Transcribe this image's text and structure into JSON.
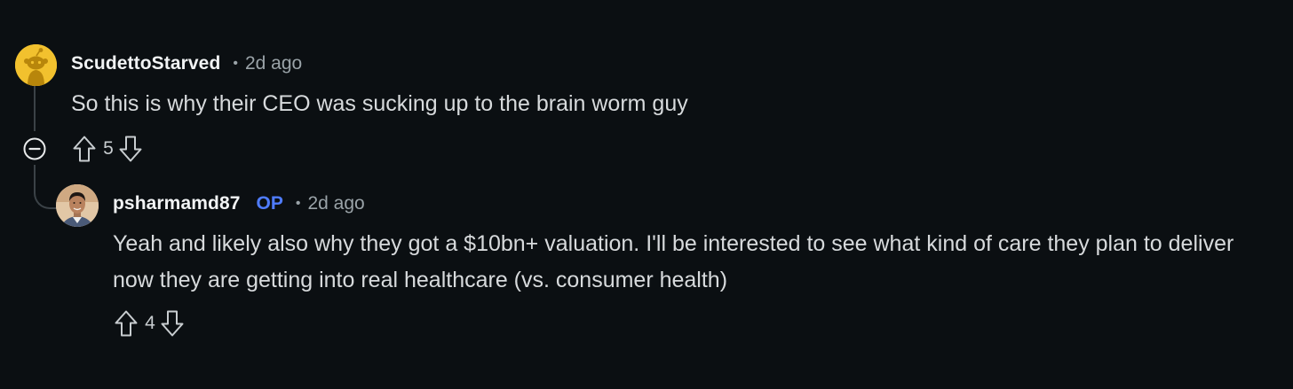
{
  "comments": [
    {
      "username": "ScudettoStarved",
      "separator": "•",
      "timestamp": "2d ago",
      "body": "So this is why their CEO was sucking up to the brain worm guy",
      "score": "5",
      "avatar_icon": "reddit-snoo-avatar-icon",
      "avatar_color": "#f2c12e"
    },
    {
      "username": "psharmamd87",
      "op_badge": "OP",
      "separator": "•",
      "timestamp": "2d ago",
      "body": "Yeah and likely also why they got a $10bn+ valuation. I'll be interested to see what kind of care they plan to deliver now they are getting into real healthcare (vs. consumer health)",
      "score": "4",
      "avatar_icon": "user-photo-avatar-icon"
    }
  ],
  "controls": {
    "collapse_icon": "collapse-thread-icon",
    "upvote_icon": "upvote-arrow-icon",
    "downvote_icon": "downvote-arrow-icon"
  },
  "colors": {
    "background": "#0b0f12",
    "text": "#d7dadc",
    "muted": "#9aa3a8",
    "op_badge": "#4f7cff",
    "thread_line": "#3b4247"
  }
}
